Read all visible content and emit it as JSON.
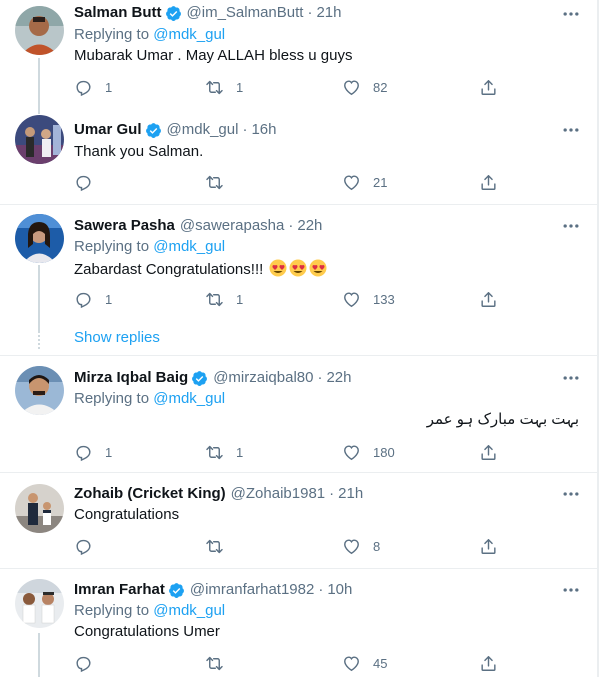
{
  "tweets": [
    {
      "name": "Salman Butt",
      "verified": true,
      "handle": "@im_SalmanButt",
      "time": "21h",
      "replying_prefix": "Replying to ",
      "replying_to": "@mdk_gul",
      "text": "Mubarak Umar . May ALLAH bless u guys",
      "replies": "1",
      "retweets": "1",
      "likes": "82"
    },
    {
      "name": "Umar Gul",
      "verified": true,
      "handle": "@mdk_gul",
      "time": "16h",
      "text": "Thank you Salman.",
      "replies": "",
      "retweets": "",
      "likes": "21"
    },
    {
      "name": "Sawera Pasha",
      "verified": false,
      "handle": "@sawerapasha",
      "time": "22h",
      "replying_prefix": "Replying to ",
      "replying_to": "@mdk_gul",
      "text": "Zabardast Congratulations!!! ",
      "emoji": "heart-eyes-emoji",
      "replies": "1",
      "retweets": "1",
      "likes": "133"
    },
    {
      "name": "Mirza Iqbal Baig",
      "verified": true,
      "handle": "@mirzaiqbal80",
      "time": "22h",
      "replying_prefix": "Replying to ",
      "replying_to": "@mdk_gul",
      "text": "بہت بہت مبارک ہو عمر",
      "replies": "1",
      "retweets": "1",
      "likes": "180"
    },
    {
      "name": "Zohaib (Cricket King)",
      "verified": false,
      "handle": "@Zohaib1981",
      "time": "21h",
      "text": "Congratulations",
      "replies": "",
      "retweets": "",
      "likes": "8"
    },
    {
      "name": "Imran Farhat",
      "verified": true,
      "handle": "@imranfarhat1982",
      "time": "10h",
      "replying_prefix": "Replying to ",
      "replying_to": "@mdk_gul",
      "text": "Congratulations Umer",
      "replies": "",
      "retweets": "",
      "likes": "45"
    }
  ],
  "show_replies": "Show replies",
  "separator": "·",
  "colors": {
    "accent": "#1da1f2",
    "secondary": "#5b7083",
    "border": "#ebeef0"
  }
}
